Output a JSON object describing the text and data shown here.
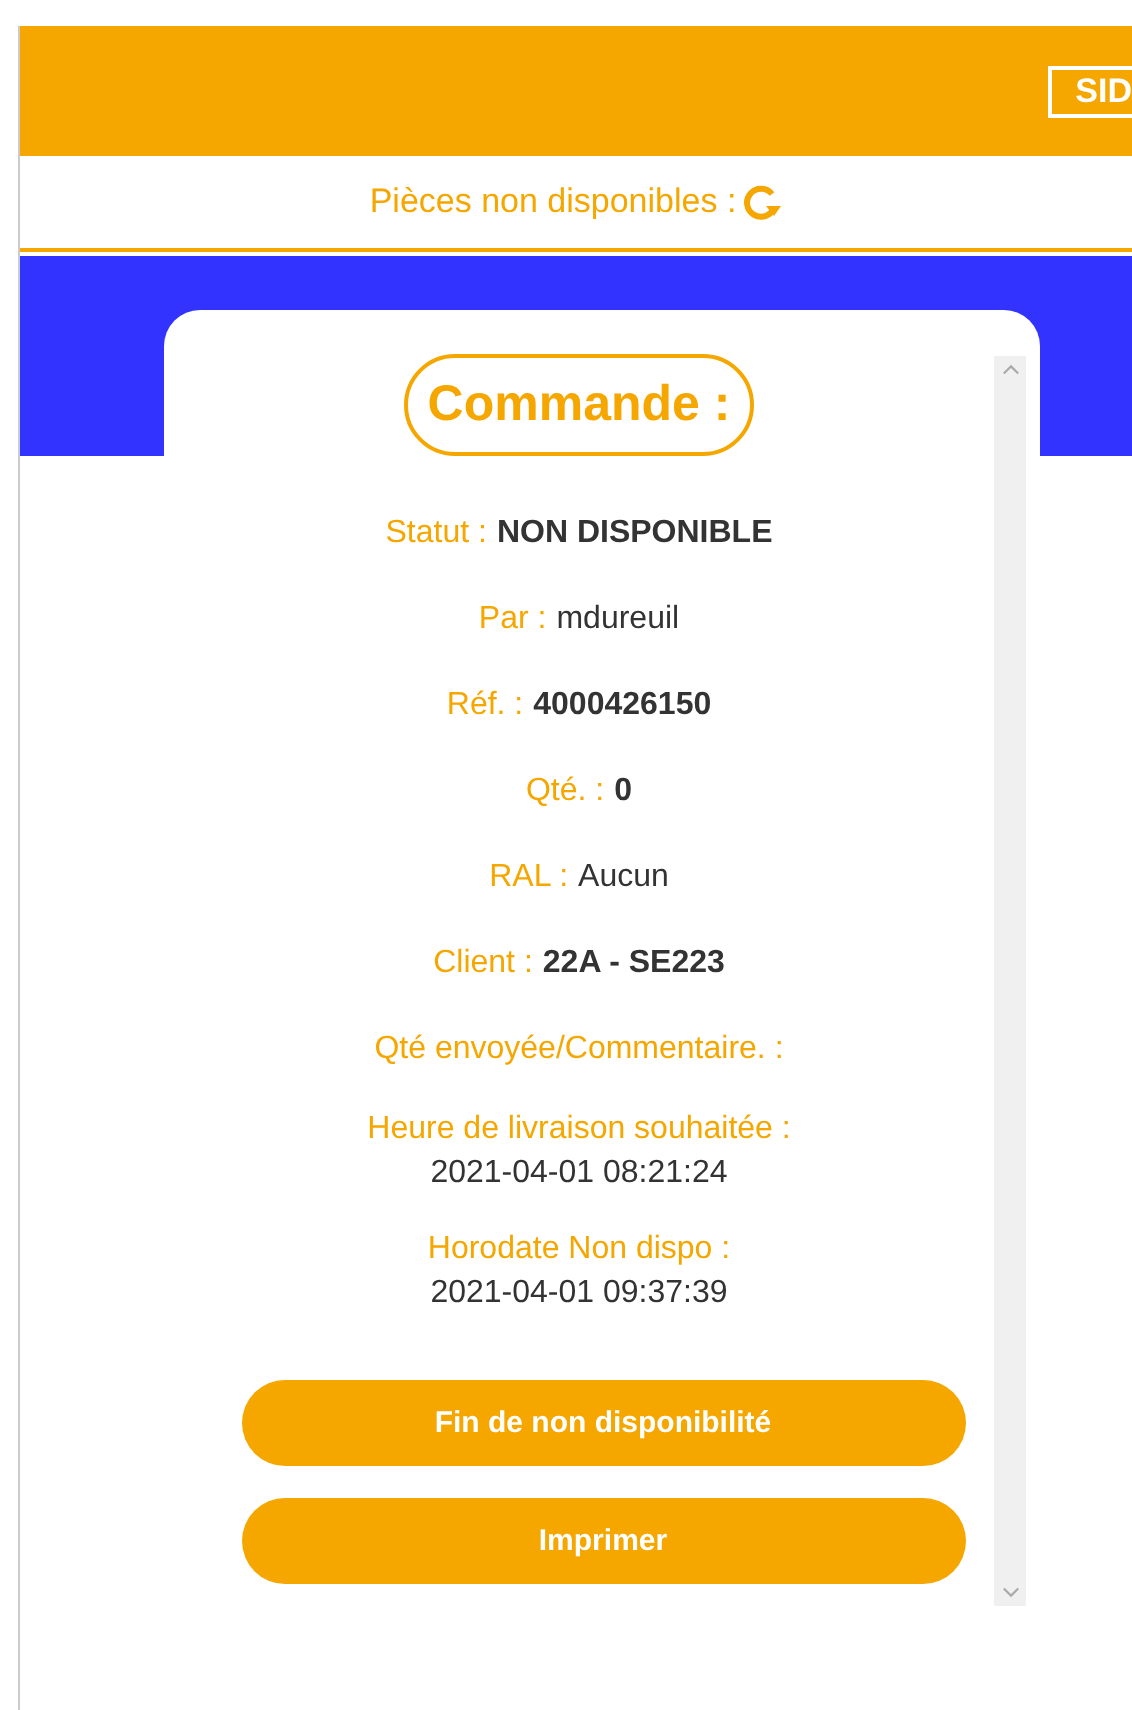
{
  "header": {
    "badge": "SID"
  },
  "subheader": {
    "title": "Pièces non disponibles :"
  },
  "card": {
    "title": "Commande :",
    "fields": [
      {
        "kind": "inline",
        "label": "Statut :",
        "value": "NON DISPONIBLE",
        "bold": true
      },
      {
        "kind": "inline",
        "label": "Par :",
        "value": "mdureuil",
        "bold": false
      },
      {
        "kind": "inline",
        "label": "Réf. :",
        "value": "4000426150",
        "bold": true
      },
      {
        "kind": "inline",
        "label": "Qté. :",
        "value": "0",
        "bold": true
      },
      {
        "kind": "inline",
        "label": "RAL :",
        "value": "Aucun",
        "bold": false
      },
      {
        "kind": "inline",
        "label": "Client :",
        "value": "22A - SE223",
        "bold": true
      },
      {
        "kind": "label",
        "label": "Qté envoyée/Commentaire. :"
      },
      {
        "kind": "stacked",
        "label": "Heure de livraison souhaitée :",
        "value": "2021-04-01 08:21:24",
        "bold": false
      },
      {
        "kind": "stacked",
        "label": "Horodate Non dispo :",
        "value": "2021-04-01 09:37:39",
        "bold": false
      }
    ],
    "buttons": [
      "Fin de non disponibilité",
      "Imprimer"
    ]
  }
}
